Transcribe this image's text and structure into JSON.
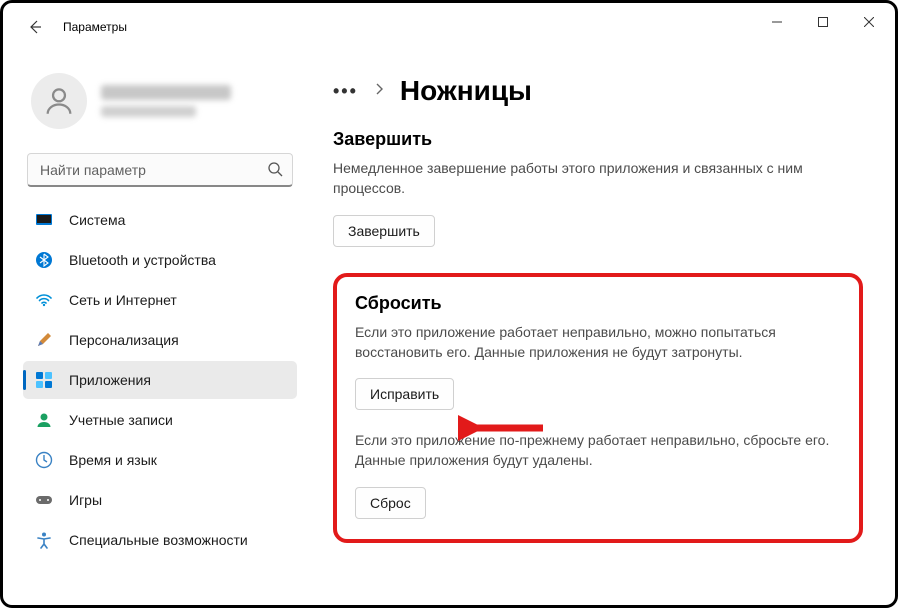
{
  "window": {
    "title": "Параметры"
  },
  "search": {
    "placeholder": "Найти параметр"
  },
  "nav": {
    "items": [
      {
        "label": "Система"
      },
      {
        "label": "Bluetooth и устройства"
      },
      {
        "label": "Сеть и Интернет"
      },
      {
        "label": "Персонализация"
      },
      {
        "label": "Приложения"
      },
      {
        "label": "Учетные записи"
      },
      {
        "label": "Время и язык"
      },
      {
        "label": "Игры"
      },
      {
        "label": "Специальные возможности"
      }
    ]
  },
  "breadcrumb": {
    "current": "Ножницы"
  },
  "terminate": {
    "heading": "Завершить",
    "desc": "Немедленное завершение работы этого приложения и связанных с ним процессов.",
    "button": "Завершить"
  },
  "reset": {
    "heading": "Сбросить",
    "desc1": "Если это приложение работает неправильно, можно попытаться восстановить его. Данные приложения не будут затронуты.",
    "repair_btn": "Исправить",
    "desc2": "Если это приложение по-прежнему работает неправильно, сбросьте его. Данные приложения будут удалены.",
    "reset_btn": "Сброс"
  },
  "colors": {
    "accent": "#0067c0",
    "highlight": "#e21a1a"
  }
}
